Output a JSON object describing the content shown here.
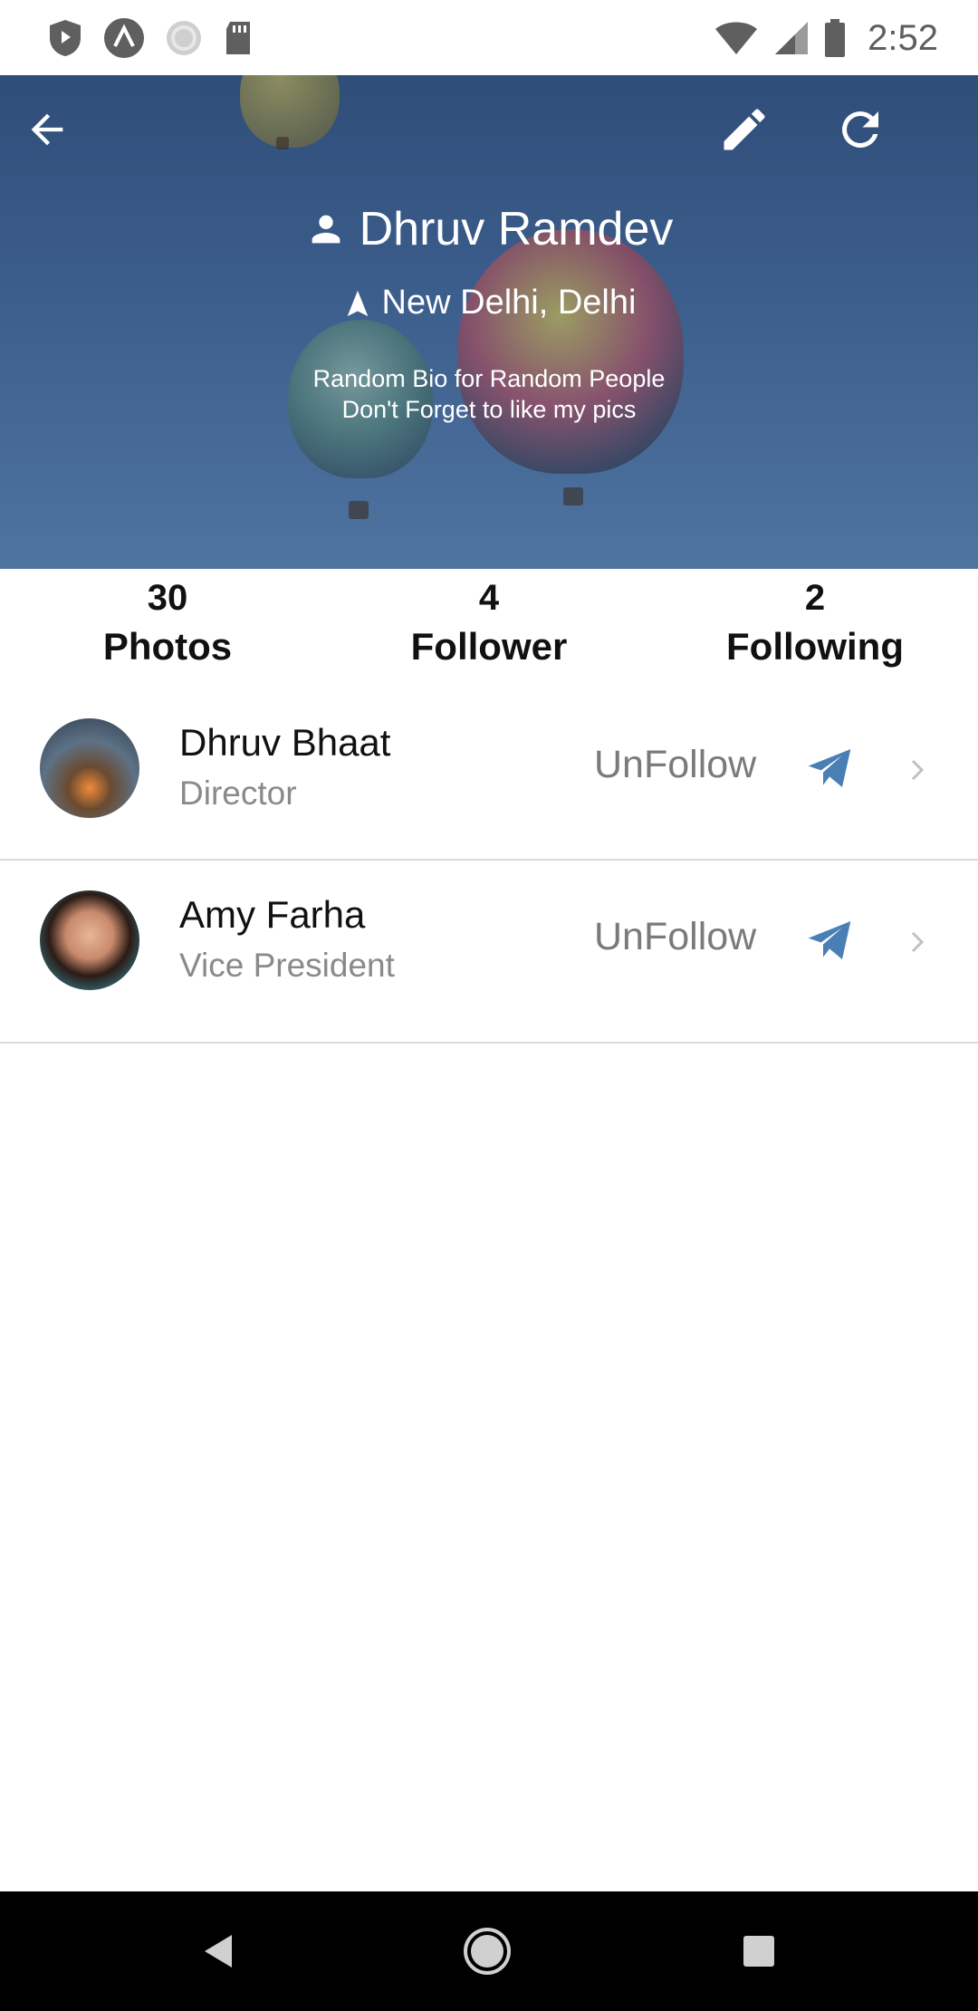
{
  "status_bar": {
    "time": "2:52",
    "left_icons": [
      "shield-icon",
      "nav-a-icon",
      "sync-icon",
      "sd-card-icon"
    ],
    "right_icons": [
      "wifi-icon",
      "cell-signal-icon",
      "battery-icon"
    ]
  },
  "header": {
    "back_icon": "arrow-back-icon",
    "edit_icon": "pencil-icon",
    "refresh_icon": "refresh-icon",
    "name": "Dhruv Ramdev",
    "location": "New Delhi, Delhi",
    "bio_line1": "Random Bio for Random People",
    "bio_line2": "Don't Forget to like my pics"
  },
  "stats": [
    {
      "value": "30",
      "label": "Photos"
    },
    {
      "value": "4",
      "label": "Follower"
    },
    {
      "value": "2",
      "label": "Following"
    }
  ],
  "following": [
    {
      "name": "Dhruv Bhaat",
      "role": "Director",
      "action": "UnFollow"
    },
    {
      "name": "Amy Farha",
      "role": "Vice President",
      "action": "UnFollow"
    }
  ],
  "colors": {
    "accent": "#4a7fb5",
    "header_bg": "#3c5e8c",
    "muted_text": "#8a8a8a"
  }
}
